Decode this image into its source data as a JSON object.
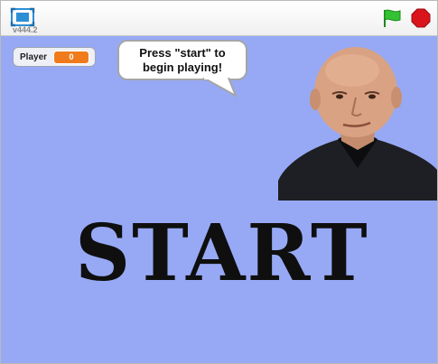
{
  "toolbar": {
    "version": "v444.2",
    "fullscreen_icon": "fullscreen-icon",
    "green_flag_icon": "green-flag-icon",
    "stop_icon": "stop-sign-icon",
    "colors": {
      "flag": "#2fbf2f",
      "stop": "#d9141b"
    }
  },
  "stage": {
    "background": "#97a9f5",
    "variable_monitor": {
      "label": "Player",
      "value": "0"
    },
    "speech_bubble": {
      "line1": "Press \"start\" to",
      "line2": "begin playing!"
    },
    "sprite_portrait": "bald-man-portrait",
    "start_button_text": "START"
  }
}
